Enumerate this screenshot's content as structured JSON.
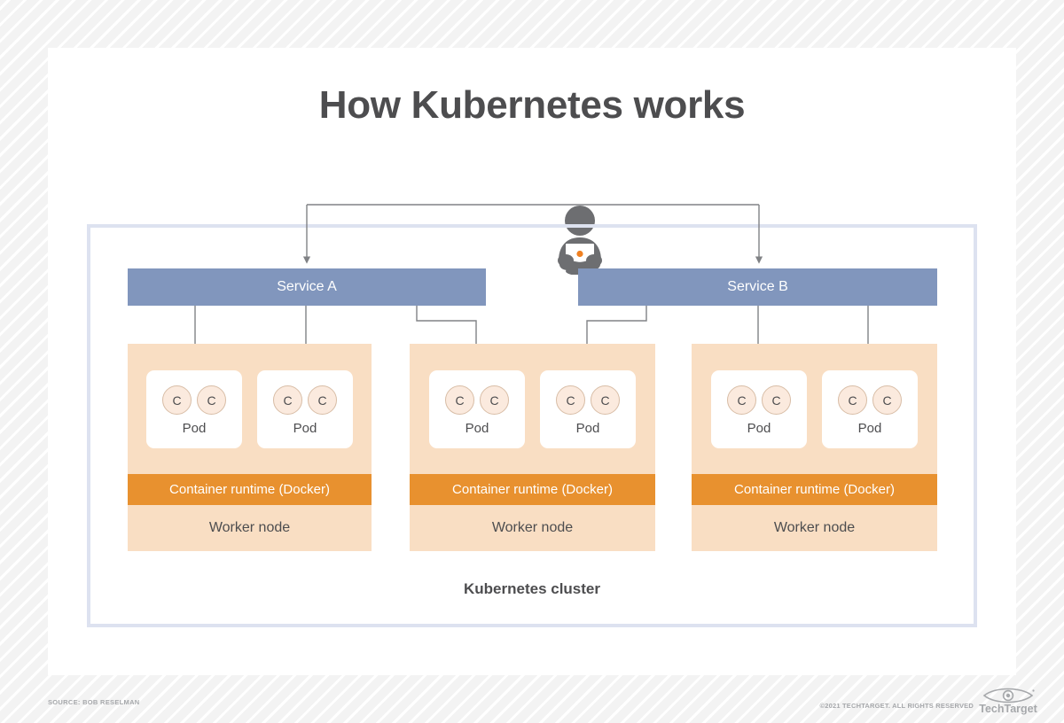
{
  "title": "How Kubernetes works",
  "diagram": {
    "actor": {
      "icon": "person-with-laptop-icon"
    },
    "cluster_label": "Kubernetes cluster",
    "services": [
      {
        "id": "service-a",
        "label": "Service A"
      },
      {
        "id": "service-b",
        "label": "Service B"
      }
    ],
    "nodes": [
      {
        "id": "node-1",
        "node_label": "Worker node",
        "runtime_label": "Container runtime (Docker)",
        "pods": [
          {
            "label": "Pod",
            "containers": [
              "C",
              "C"
            ]
          },
          {
            "label": "Pod",
            "containers": [
              "C",
              "C"
            ]
          }
        ]
      },
      {
        "id": "node-2",
        "node_label": "Worker node",
        "runtime_label": "Container runtime (Docker)",
        "pods": [
          {
            "label": "Pod",
            "containers": [
              "C",
              "C"
            ]
          },
          {
            "label": "Pod",
            "containers": [
              "C",
              "C"
            ]
          }
        ]
      },
      {
        "id": "node-3",
        "node_label": "Worker node",
        "runtime_label": "Container runtime (Docker)",
        "pods": [
          {
            "label": "Pod",
            "containers": [
              "C",
              "C"
            ]
          },
          {
            "label": "Pod",
            "containers": [
              "C",
              "C"
            ]
          }
        ]
      }
    ]
  },
  "footer": {
    "source": "SOURCE: BOB RESELMAN",
    "copyright": "©2021 TECHTARGET. ALL RIGHTS RESERVED",
    "logo_text": "TechTarget",
    "logo_icon": "eye-icon"
  },
  "colors": {
    "service_blue": "#8196bd",
    "node_peach": "#f9dec3",
    "runtime_orange": "#e8912f",
    "cluster_border": "#dde2f0",
    "text_dark": "#4d4d4f",
    "connector_gray": "#808285",
    "accent_orange": "#f08122"
  }
}
